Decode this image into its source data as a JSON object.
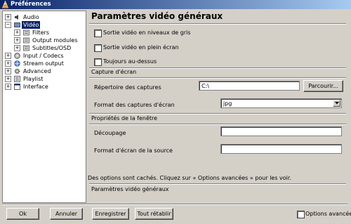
{
  "window": {
    "title": "Préférences"
  },
  "tree": [
    {
      "label": "Audio",
      "expander": "+",
      "icon": "audio-icon"
    },
    {
      "label": "Vidéo",
      "expander": "−",
      "icon": "video-icon",
      "selected": true
    },
    {
      "label": "Filters",
      "expander": "+",
      "icon": "filters-icon"
    },
    {
      "label": "Output modules",
      "expander": "+",
      "icon": "output-modules-icon"
    },
    {
      "label": "Subtitles/OSD",
      "expander": "+",
      "icon": "subtitles-icon"
    },
    {
      "label": "Input / Codecs",
      "expander": "+",
      "icon": "input-codecs-icon"
    },
    {
      "label": "Stream output",
      "expander": "+",
      "icon": "stream-output-icon"
    },
    {
      "label": "Advanced",
      "expander": "+",
      "icon": "advanced-icon"
    },
    {
      "label": "Playlist",
      "expander": "+",
      "icon": "playlist-icon"
    },
    {
      "label": "Interface",
      "expander": "+",
      "icon": "interface-icon"
    }
  ],
  "panel": {
    "title": "Paramètres vidéo généraux",
    "checkbox_grayscale": "Sortie vidéo en niveaux de gris",
    "checkbox_fullscreen": "Sortie vidéo en plein écran",
    "checkbox_ontop": "Toujours au-dessus",
    "section_capture": "Capture d'écran",
    "capture_dir_label": "Répertoire des captures",
    "capture_dir_value": "C:\\",
    "browse_button": "Parcourir...",
    "capture_format_label": "Format des captures d'écran",
    "capture_format_value": "jpg",
    "section_window": "Propriétés de la fenêtre",
    "crop_label": "Découpage",
    "crop_value": "",
    "aspect_label": "Format d'écran de la source",
    "aspect_value": "",
    "hidden_info": "Des options sont cachés. Cliquez sur « Options avancées » pour les voir.",
    "footer_title": "Paramètres vidéo généraux"
  },
  "buttons": {
    "ok": "Ok",
    "cancel": "Annuler",
    "save": "Enregistrer",
    "reset": "Tout rétablir"
  },
  "advanced_options": {
    "label": "Options avancées",
    "checked": false
  },
  "colors": {
    "title_start": "#0a246a",
    "title_end": "#a6caf0",
    "selection": "#0a246a",
    "face": "#d4d0c8"
  }
}
